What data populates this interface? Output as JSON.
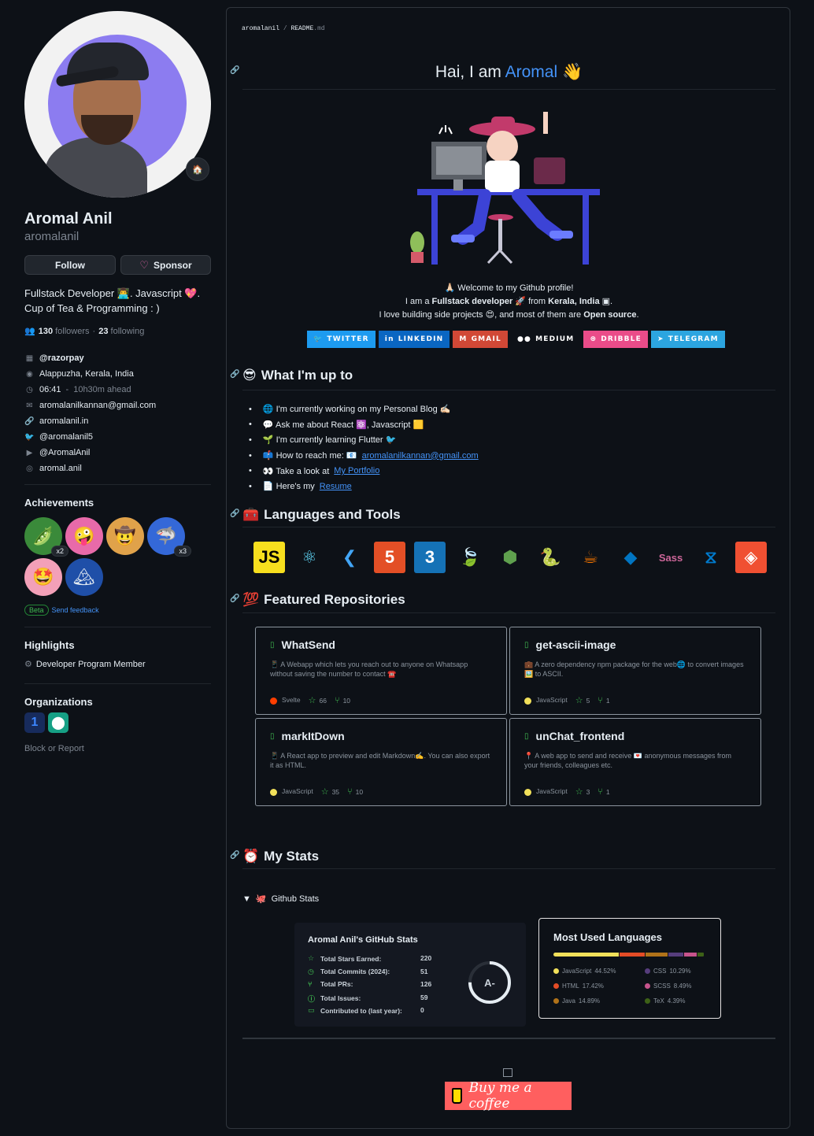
{
  "profile": {
    "name": "Aromal Anil",
    "login": "aromalanil",
    "status_emoji": "🏠",
    "follow_label": "Follow",
    "sponsor_label": "Sponsor",
    "bio_line1": "Fullstack Developer 👨‍💻. Javascript 💖.",
    "bio_line2": "Cup of Tea & Programming : )",
    "followers_count": "130",
    "followers_label": "followers",
    "following_sep": "·",
    "following_count": "23",
    "following_label": "following",
    "org": "@razorpay",
    "location": "Alappuzha, Kerala, India",
    "time": "06:41",
    "time_sep": "-",
    "time_offset": "10h30m ahead",
    "email": "aromalanilkannan@gmail.com",
    "website": "aromalanil.in",
    "twitter": "@aromalanil5",
    "youtube": "@AromalAnil",
    "instagram": "aromal.anil"
  },
  "achievements": {
    "heading": "Achievements",
    "items": [
      {
        "name": "pair-extraordinaire",
        "emoji": "🫛",
        "bg": "#3a8a3a",
        "mult": "x2"
      },
      {
        "name": "yolo",
        "emoji": "🤪",
        "bg": "#e86aa9",
        "mult": ""
      },
      {
        "name": "quickdraw",
        "emoji": "🤠",
        "bg": "#e0a24a",
        "mult": ""
      },
      {
        "name": "pull-shark",
        "emoji": "🦈",
        "bg": "#3468d8",
        "mult": "x3"
      },
      {
        "name": "starstruck",
        "emoji": "🤩",
        "bg": "#f3a0b8",
        "mult": ""
      },
      {
        "name": "arctic-vault",
        "emoji": "🏔",
        "bg": "#1f4fa8",
        "mult": ""
      }
    ],
    "beta_label": "Beta",
    "feedback_label": "Send feedback"
  },
  "highlights": {
    "heading": "Highlights",
    "item": "Developer Program Member"
  },
  "organizations": {
    "heading": "Organizations",
    "items": [
      {
        "glyph": "1",
        "bg": "#172b5c",
        "fg": "#3c86ff"
      },
      {
        "glyph": "⬤",
        "bg": "#16a085",
        "fg": "#ffffff"
      }
    ]
  },
  "block_report": "Block or Report",
  "readme": {
    "crumb_user": "aromalanil",
    "crumb_sep": "/",
    "crumb_file": "README",
    "crumb_ext": ".md",
    "title_prefix": "Hai, I am",
    "title_name": "Aromal",
    "title_emoji": "👋",
    "welcome": "🙏🏻 Welcome to my Github profile!",
    "intro_a": "I am a",
    "intro_b": "Fullstack developer",
    "intro_c": "🚀 from",
    "intro_d": "Kerala, India",
    "intro_e": ".",
    "love_a": "I love building side projects 😍, and most of them are",
    "love_b": "Open source",
    "love_c": ".",
    "socials": [
      {
        "label": "TWITTER",
        "bg": "#1d9bf0",
        "icon": "🐦"
      },
      {
        "label": "LINKEDIN",
        "bg": "#0a66c2",
        "icon": "in"
      },
      {
        "label": "GMAIL",
        "bg": "#d14836",
        "icon": "M"
      },
      {
        "label": "MEDIUM",
        "bg": "#0d1117",
        "icon": "●●"
      },
      {
        "label": "DRIBBLE",
        "bg": "#ea4c89",
        "icon": "⊛"
      },
      {
        "label": "TELEGRAM",
        "bg": "#2ca5e0",
        "icon": "➤"
      }
    ],
    "upto_heading": "What I'm up to",
    "upto_emoji": "😎",
    "upto": [
      {
        "text": "🌐 I'm currently working on my Personal Blog ✍🏻",
        "link": ""
      },
      {
        "text": "💬 Ask me about React ⚛️, Javascript 🟨",
        "link": ""
      },
      {
        "text": "🌱 I'm currently learning Flutter 🐦",
        "link": ""
      },
      {
        "text": "📫 How to reach me: 📧",
        "link": "aromalanilkannan@gmail.com"
      },
      {
        "text": "👀 Take a look at",
        "link": "My Portfolio"
      },
      {
        "text": "📄 Here's my",
        "link": "Resume"
      }
    ],
    "tools_heading": "Languages and Tools",
    "tools_emoji": "🧰",
    "tools": [
      {
        "name": "javascript-icon",
        "glyph": "JS",
        "bg": "#f7df1e",
        "fg": "#000"
      },
      {
        "name": "react-icon",
        "glyph": "⚛",
        "bg": "transparent",
        "fg": "#61dafb"
      },
      {
        "name": "flutter-icon",
        "glyph": "❮",
        "bg": "transparent",
        "fg": "#42a5f5"
      },
      {
        "name": "html5-icon",
        "glyph": "5",
        "bg": "#e34f26",
        "fg": "#fff"
      },
      {
        "name": "css3-icon",
        "glyph": "3",
        "bg": "#1572b6",
        "fg": "#fff"
      },
      {
        "name": "mongodb-icon",
        "glyph": "🍃",
        "bg": "transparent",
        "fg": "#47a248"
      },
      {
        "name": "nodejs-icon",
        "glyph": "⬢",
        "bg": "transparent",
        "fg": "#5fa04e"
      },
      {
        "name": "python-icon",
        "glyph": "🐍",
        "bg": "transparent",
        "fg": "#ffd43b"
      },
      {
        "name": "java-icon",
        "glyph": "☕",
        "bg": "transparent",
        "fg": "#e76f00"
      },
      {
        "name": "dart-icon",
        "glyph": "◆",
        "bg": "transparent",
        "fg": "#0175c2"
      },
      {
        "name": "sass-icon",
        "glyph": "Sass",
        "bg": "transparent",
        "fg": "#cc6699"
      },
      {
        "name": "vscode-icon",
        "glyph": "⧖",
        "bg": "transparent",
        "fg": "#007acc"
      },
      {
        "name": "git-icon",
        "glyph": "◈",
        "bg": "#f05032",
        "fg": "#fff"
      }
    ],
    "repos_heading": "Featured Repositories",
    "repos_emoji": "💯",
    "repos": [
      {
        "name": "WhatSend",
        "desc": "📱 A Webapp which lets you reach out to anyone on Whatsapp without saving the number to contact ☎️",
        "lang": "Svelte",
        "lang_color": "#ff3e00",
        "stars": "66",
        "forks": "10"
      },
      {
        "name": "get-ascii-image",
        "desc": "💼 A zero dependency npm package for the web🌐 to convert images 🖼️ to ASCII.",
        "lang": "JavaScript",
        "lang_color": "#f1e05a",
        "stars": "5",
        "forks": "1"
      },
      {
        "name": "markItDown",
        "desc": "📱 A React app to preview and edit Markdown✍️. You can also export it as HTML.",
        "lang": "JavaScript",
        "lang_color": "#f1e05a",
        "stars": "35",
        "forks": "10"
      },
      {
        "name": "unChat_frontend",
        "desc": "📍 A web app to send and receive 💌 anonymous messages from your friends, colleagues etc.",
        "lang": "JavaScript",
        "lang_color": "#f1e05a",
        "stars": "3",
        "forks": "1"
      }
    ],
    "stats_heading": "My Stats",
    "stats_emoji": "⏰",
    "summary_label": "Github Stats",
    "summary_emoji": "🐙",
    "stats": {
      "title": "Aromal Anil's GitHub Stats",
      "rows": [
        {
          "label": "Total Stars Earned:",
          "value": "220",
          "icon": "☆"
        },
        {
          "label": "Total Commits (2024):",
          "value": "51",
          "icon": "◷"
        },
        {
          "label": "Total PRs:",
          "value": "126",
          "icon": "⑂"
        },
        {
          "label": "Total Issues:",
          "value": "59",
          "icon": "ⓘ"
        },
        {
          "label": "Contributed to (last year):",
          "value": "0",
          "icon": "▭"
        }
      ],
      "grade": "A-",
      "grade_progress": 0.75
    },
    "languages": {
      "title": "Most Used Languages",
      "items": [
        {
          "name": "JavaScript",
          "pct": "44.52%",
          "value": 44.52,
          "color": "#f1e05a"
        },
        {
          "name": "CSS",
          "pct": "10.29%",
          "value": 10.29,
          "color": "#563d7c"
        },
        {
          "name": "HTML",
          "pct": "17.42%",
          "value": 17.42,
          "color": "#e34c26"
        },
        {
          "name": "SCSS",
          "pct": "8.49%",
          "value": 8.49,
          "color": "#c6538c"
        },
        {
          "name": "Java",
          "pct": "14.89%",
          "value": 14.89,
          "color": "#b07219"
        },
        {
          "name": "TeX",
          "pct": "4.39%",
          "value": 4.39,
          "color": "#3d6117"
        }
      ],
      "bar_order": [
        "JavaScript",
        "HTML",
        "Java",
        "CSS",
        "SCSS",
        "TeX"
      ]
    },
    "coffee_label": "Buy me a coffee"
  }
}
